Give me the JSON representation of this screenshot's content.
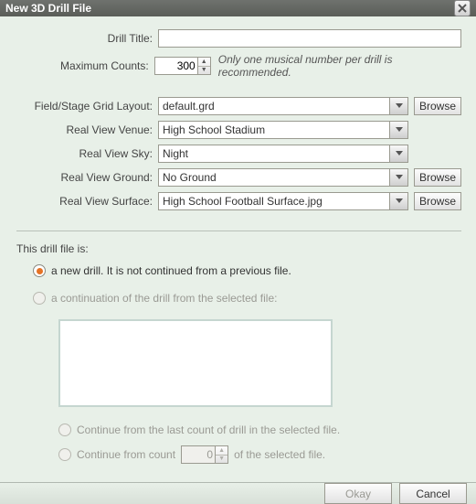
{
  "title": "New 3D Drill File",
  "labels": {
    "drill_title": "Drill Title:",
    "max_counts": "Maximum Counts:",
    "field_layout": "Field/Stage Grid Layout:",
    "venue": "Real View Venue:",
    "sky": "Real View Sky:",
    "ground": "Real View Ground:",
    "surface": "Real View Surface:"
  },
  "values": {
    "drill_title": "",
    "max_counts": "300",
    "field_layout": "default.grd",
    "venue": "High School Stadium",
    "sky": "Night",
    "ground": "No Ground",
    "surface": "High School Football Surface.jpg"
  },
  "hint": "Only one musical number per drill is recommended.",
  "browse_label": "Browse",
  "section": {
    "heading": "This drill file is:",
    "opt_new": "a new drill.  It is not continued from a previous file.",
    "opt_cont": "a continuation of the drill from the selected file:",
    "sub_last": "Continue from the last count of drill in the selected file.",
    "sub_count_pre": "Continue from count",
    "sub_count_val": "0",
    "sub_count_post": "of the selected file."
  },
  "buttons": {
    "okay": "Okay",
    "cancel": "Cancel"
  }
}
